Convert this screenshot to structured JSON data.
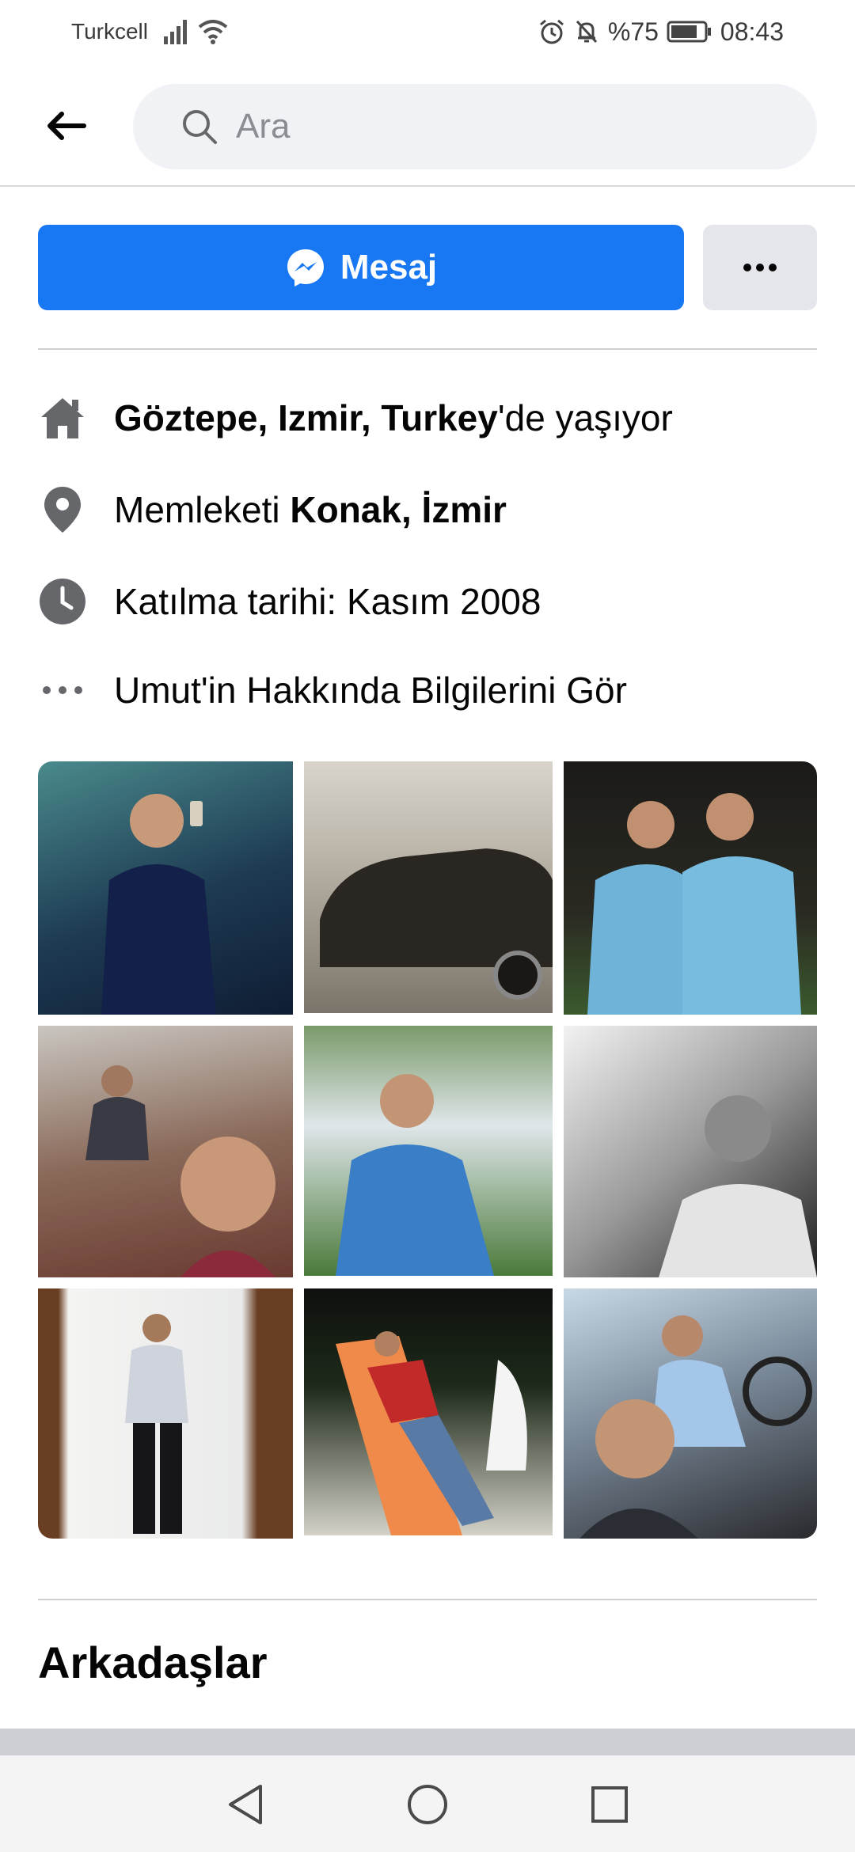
{
  "status_bar": {
    "carrier": "Turkcell",
    "battery": "%75",
    "time": "08:43"
  },
  "search": {
    "placeholder": "Ara"
  },
  "actions": {
    "message_label": "Mesaj"
  },
  "info": {
    "lives_in": {
      "bold": "Göztepe, Izmir, Turkey",
      "suffix": "'de yaşıyor"
    },
    "hometown": {
      "prefix": "Memleketi ",
      "bold": "Konak, İzmir"
    },
    "joined": "Katılma tarihi: Kasım 2008",
    "see_about": "Umut'in Hakkında Bilgilerini Gör"
  },
  "photos": [
    {
      "alt": "photo-1"
    },
    {
      "alt": "photo-2"
    },
    {
      "alt": "photo-3"
    },
    {
      "alt": "photo-4"
    },
    {
      "alt": "photo-5"
    },
    {
      "alt": "photo-6"
    },
    {
      "alt": "photo-7"
    },
    {
      "alt": "photo-8"
    },
    {
      "alt": "photo-9"
    }
  ],
  "friends": {
    "title": "Arkadaşlar"
  },
  "colors": {
    "accent": "#1877f2",
    "secondary_button": "#e4e6eb",
    "icon_gray": "#65676b"
  }
}
